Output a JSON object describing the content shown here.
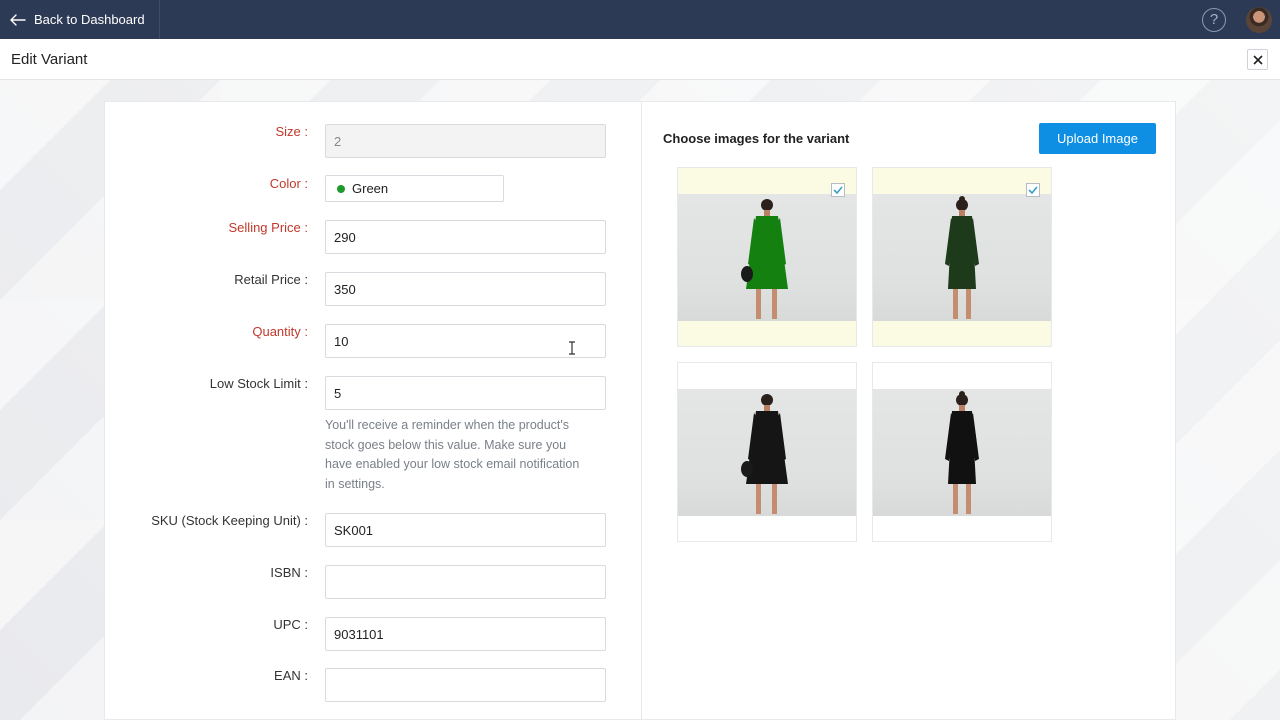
{
  "topbar": {
    "back_label": "Back to Dashboard",
    "help_symbol": "?"
  },
  "header": {
    "title": "Edit Variant",
    "close_icon": "close-icon"
  },
  "form": {
    "size": {
      "label": "Size :",
      "value": "2"
    },
    "color": {
      "label": "Color :",
      "value": "Green",
      "swatch": "#1e9a2c"
    },
    "selling_price": {
      "label": "Selling Price :",
      "value": "290"
    },
    "retail_price": {
      "label": "Retail Price :",
      "value": "350"
    },
    "quantity": {
      "label": "Quantity :",
      "value": "10"
    },
    "low_stock": {
      "label": "Low Stock Limit :",
      "value": "5",
      "help_lines": [
        "You'll receive a reminder when the product's",
        "stock goes below this value. Make sure you",
        "have enabled your low stock email notification",
        "in settings."
      ]
    },
    "sku": {
      "label": "SKU (Stock Keeping Unit) :",
      "value": "SK001"
    },
    "isbn": {
      "label": "ISBN :",
      "value": ""
    },
    "upc": {
      "label": "UPC :",
      "value": "9031101"
    },
    "ean": {
      "label": "EAN :",
      "value": ""
    }
  },
  "images": {
    "title": "Choose images for the variant",
    "upload_label": "Upload Image",
    "items": [
      {
        "dress_color": "#13800f",
        "view": "front",
        "selected": true
      },
      {
        "dress_color": "#1d3a1a",
        "view": "back",
        "selected": true
      },
      {
        "dress_color": "#151515",
        "view": "front",
        "selected": false
      },
      {
        "dress_color": "#111111",
        "view": "back",
        "selected": false
      }
    ]
  }
}
